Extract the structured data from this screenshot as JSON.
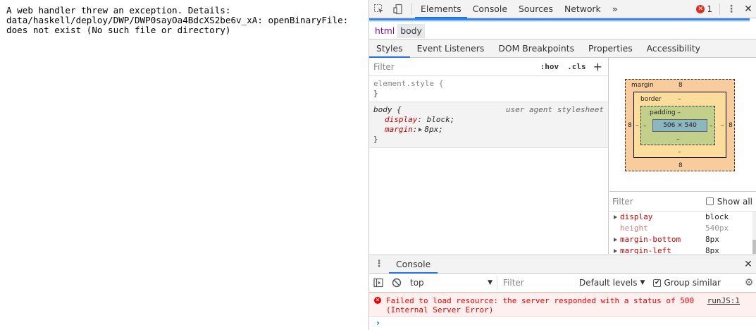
{
  "page": {
    "error_text": "A web handler threw an exception. Details:\ndata/haskell/deploy/DWP/DWP0sayOa4BdcXS2be6v_xA: openBinaryFile:\ndoes not exist (No such file or directory)"
  },
  "devtools": {
    "tabs": [
      "Elements",
      "Console",
      "Sources",
      "Network"
    ],
    "more_tabs": "»",
    "error_count": "1",
    "breadcrumbs": [
      "html",
      "body"
    ],
    "sub_tabs": [
      "Styles",
      "Event Listeners",
      "DOM Breakpoints",
      "Properties",
      "Accessibility"
    ],
    "styles": {
      "filter_placeholder": "Filter",
      "hov_label": ":hov",
      "cls_label": ".cls",
      "add_label": "+",
      "element_style_selector": "element.style {",
      "element_style_close": "}",
      "ua_selector": "body {",
      "ua_source": "user agent stylesheet",
      "ua_props": [
        {
          "name": "display",
          "value": "block;"
        },
        {
          "name": "margin",
          "value": "8px;"
        }
      ],
      "ua_close": "}"
    },
    "box_model": {
      "margin_label": "margin",
      "margin_top": "8",
      "margin_bottom": "8",
      "margin_left": "8",
      "margin_right": "8",
      "border_label": "border",
      "border_top": "–",
      "border_bottom": "–",
      "border_left": "–",
      "border_right": "–",
      "padding_label": "padding –",
      "padding_bottom": "–",
      "padding_left": "–",
      "padding_right": "–",
      "content_size": "506 × 540"
    },
    "computed": {
      "filter_placeholder": "Filter",
      "show_all_label": "Show all",
      "rows": [
        {
          "name": "display",
          "value": "block",
          "inherited": false,
          "expandable": true
        },
        {
          "name": "height",
          "value": "540px",
          "inherited": true,
          "expandable": false
        },
        {
          "name": "margin-bottom",
          "value": "8px",
          "inherited": false,
          "expandable": true
        },
        {
          "name": "margin-left",
          "value": "8px",
          "inherited": false,
          "expandable": true
        }
      ]
    },
    "console": {
      "drawer_tab": "Console",
      "context": "top",
      "filter_placeholder": "Filter",
      "levels_label": "Default levels",
      "group_similar_label": "Group similar",
      "group_similar_checked": "✔",
      "error_message": "Failed to load resource: the server responded with a status of 500\n(Internal Server Error)",
      "error_source": "runJS:1",
      "prompt": "›"
    }
  }
}
